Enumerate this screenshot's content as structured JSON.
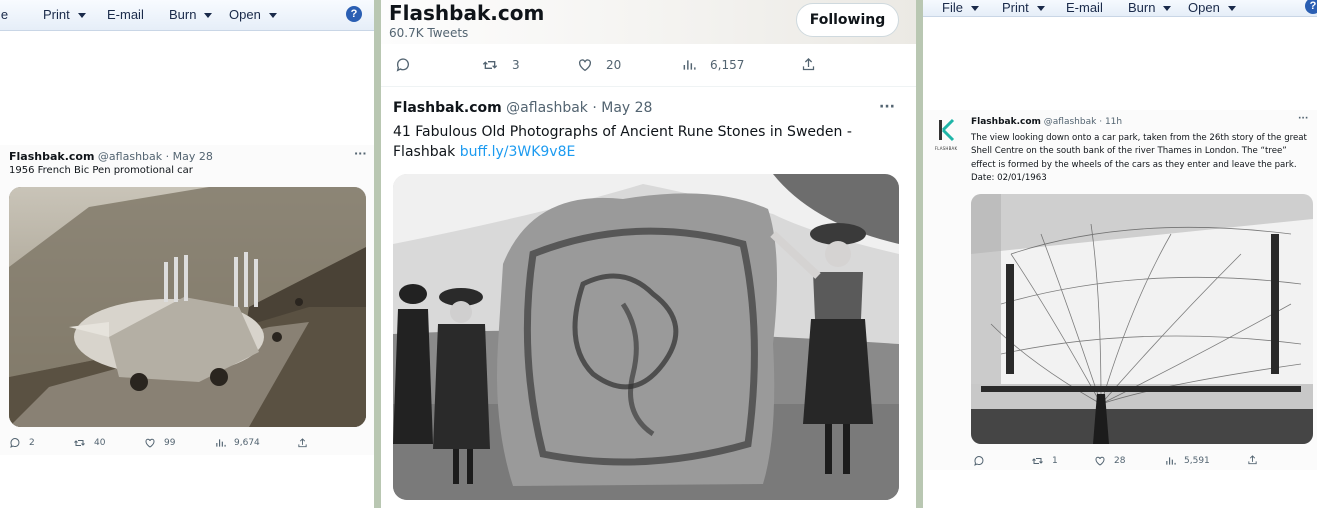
{
  "left_pane": {
    "toolbar": [
      {
        "label": "le",
        "caret": false
      },
      {
        "label": "Print",
        "caret": true
      },
      {
        "label": "E-mail",
        "caret": false
      },
      {
        "label": "Burn",
        "caret": true
      },
      {
        "label": "Open",
        "caret": true
      }
    ],
    "help_label": "?",
    "tweet": {
      "name": "Flashbak.com",
      "handle": "@aflashbak",
      "sep": "·",
      "date": "May 28",
      "more": "···",
      "text": "1956 French Bic Pen promotional car",
      "replies": "2",
      "retweets": "40",
      "likes": "99",
      "views": "9,674"
    }
  },
  "middle_pane": {
    "header": {
      "title": "Flashbak.com",
      "tweet_count": "60.7K Tweets",
      "follow_label": "Following"
    },
    "prev_actions": {
      "retweets": "3",
      "likes": "20",
      "views": "6,157"
    },
    "tweet": {
      "name": "Flashbak.com",
      "handle": "@aflashbak",
      "sep": "·",
      "date": "May 28",
      "more": "···",
      "text_line1": "41 Fabulous Old Photographs of Ancient Rune Stones in Sweden -",
      "text_line2": "Flashbak",
      "link": "buff.ly/3WK9v8E"
    }
  },
  "right_pane": {
    "toolbar": [
      {
        "label": "File",
        "caret": true
      },
      {
        "label": "Print",
        "caret": true
      },
      {
        "label": "E-mail",
        "caret": false
      },
      {
        "label": "Burn",
        "caret": true
      },
      {
        "label": "Open",
        "caret": true
      }
    ],
    "help_label": "?",
    "tweet": {
      "avatar_text": "FLASHBAK",
      "name": "Flashbak.com",
      "handle": "@aflashbak",
      "sep": "·",
      "date": "11h",
      "more": "···",
      "text": "The view looking down onto a car park, taken from the 26th story of the great Shell Centre on the south bank of the river Thames in London. The “tree” effect is formed by the wheels of the cars as they enter and leave the park. Date: 02/01/1963",
      "retweets": "1",
      "likes": "28",
      "views": "5,591"
    }
  },
  "colors": {
    "accent": "#1d9bf0",
    "muted": "#536471",
    "toolbar_bg": "#e6eef8",
    "divider": "#b9c7b2"
  }
}
